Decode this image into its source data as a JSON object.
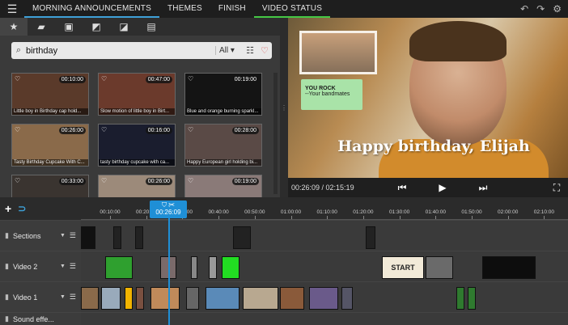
{
  "tabs": [
    "MORNING ANNOUNCEMENTS",
    "THEMES",
    "FINISH",
    "VIDEO STATUS"
  ],
  "search": {
    "value": "birthday",
    "filter": "All"
  },
  "thumbs": [
    {
      "dur": "00:10:00",
      "cap": "Little boy in Birthday cap hold...",
      "color": "#5a3a2a"
    },
    {
      "dur": "00:47:00",
      "cap": "Slow motion of little boy in Birt...",
      "color": "#6b3a2c"
    },
    {
      "dur": "00:19:00",
      "cap": "Blue and orange burning sparkl...",
      "color": "#141414"
    },
    {
      "dur": "00:26:00",
      "cap": "Tasty Birthday Cupcake With C...",
      "color": "#8a6a4a"
    },
    {
      "dur": "00:16:00",
      "cap": "tasty birthday cupcake with ca...",
      "color": "#1a1d2e"
    },
    {
      "dur": "00:28:00",
      "cap": "Happy European girl holding bi...",
      "color": "#5a4a46"
    },
    {
      "dur": "00:33:00",
      "cap": "",
      "color": "#3a3430"
    },
    {
      "dur": "00:26:00",
      "cap": "",
      "color": "#9c8a7a"
    },
    {
      "dur": "00:19:00",
      "cap": "",
      "color": "#8a7a78"
    }
  ],
  "preview": {
    "note_line1": "YOU ROCK",
    "note_line2": "--Your bandmates",
    "title": "Happy birthday, Elijah",
    "time": "00:26:09 / 02:15:19"
  },
  "timeline": {
    "playhead_time": "00:26:09",
    "ticks": [
      "00:10:00",
      "00:20:00",
      "00:30:00",
      "00:40:00",
      "00:50:00",
      "01:00:00",
      "01:10:00",
      "01:20:00",
      "01:30:00",
      "01:40:00",
      "01:50:00",
      "02:00:00",
      "02:10:00"
    ]
  },
  "tracks": [
    {
      "name": "Sections"
    },
    {
      "name": "Video 2"
    },
    {
      "name": "Video 1"
    },
    {
      "name": "Sound effe..."
    }
  ],
  "clip_labels": {
    "start": "START"
  }
}
